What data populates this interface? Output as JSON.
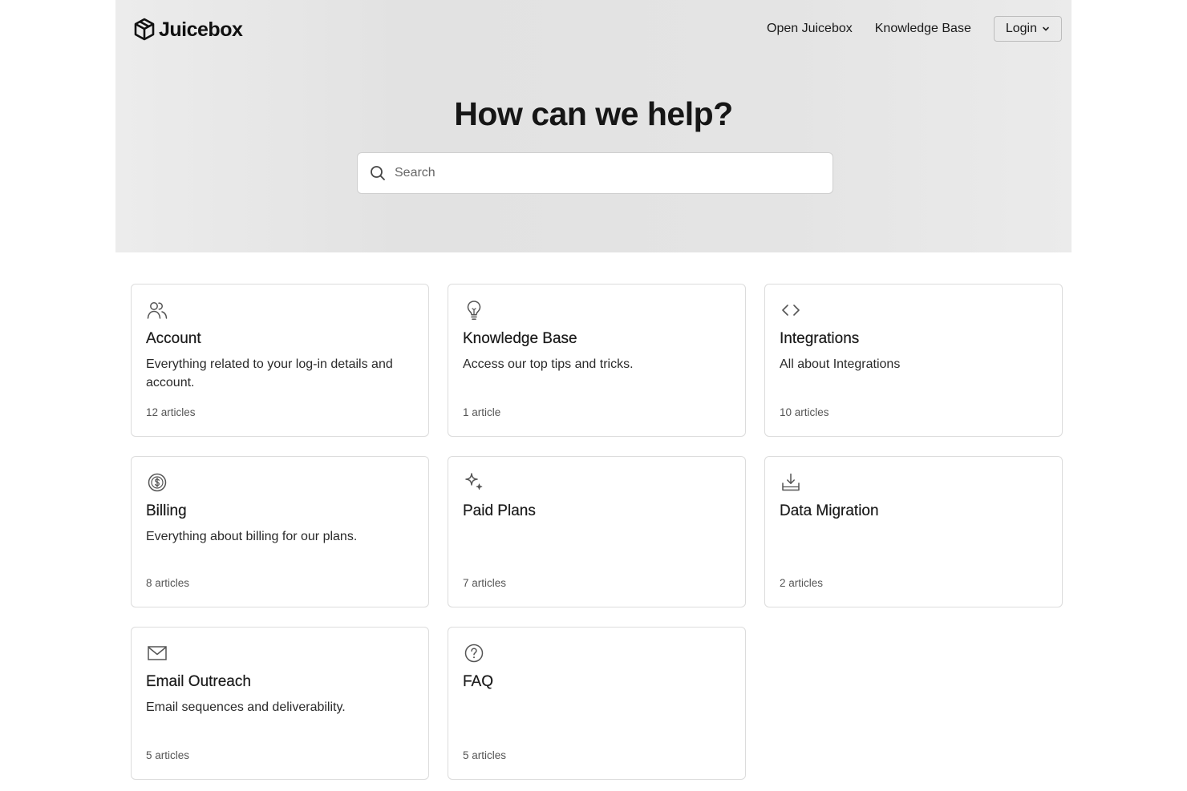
{
  "brand": {
    "name": "Juicebox"
  },
  "nav": {
    "open_app": "Open Juicebox",
    "knowledge_base": "Knowledge Base",
    "login": "Login"
  },
  "hero": {
    "title": "How can we help?"
  },
  "search": {
    "placeholder": "Search",
    "value": ""
  },
  "colors": {
    "hero_background": "#e4e4e4",
    "card_border": "#dcdcdc",
    "icon_stroke": "#555555"
  },
  "collections": [
    {
      "icon": "users-icon",
      "title": "Account",
      "description": "Everything related to your log-in details and account.",
      "count": "12 articles"
    },
    {
      "icon": "lightbulb-icon",
      "title": "Knowledge Base",
      "description": "Access our top tips and tricks.",
      "count": "1 article"
    },
    {
      "icon": "code-icon",
      "title": "Integrations",
      "description": "All about Integrations",
      "count": "10 articles"
    },
    {
      "icon": "dollar-circle-icon",
      "title": "Billing",
      "description": "Everything about billing for our plans.",
      "count": "8 articles"
    },
    {
      "icon": "sparkles-icon",
      "title": "Paid Plans",
      "description": "",
      "count": "7 articles"
    },
    {
      "icon": "download-tray-icon",
      "title": "Data Migration",
      "description": "",
      "count": "2 articles"
    },
    {
      "icon": "mail-icon",
      "title": "Email Outreach",
      "description": "Email sequences and deliverability.",
      "count": "5 articles"
    },
    {
      "icon": "question-circle-icon",
      "title": "FAQ",
      "description": "",
      "count": "5 articles"
    }
  ]
}
